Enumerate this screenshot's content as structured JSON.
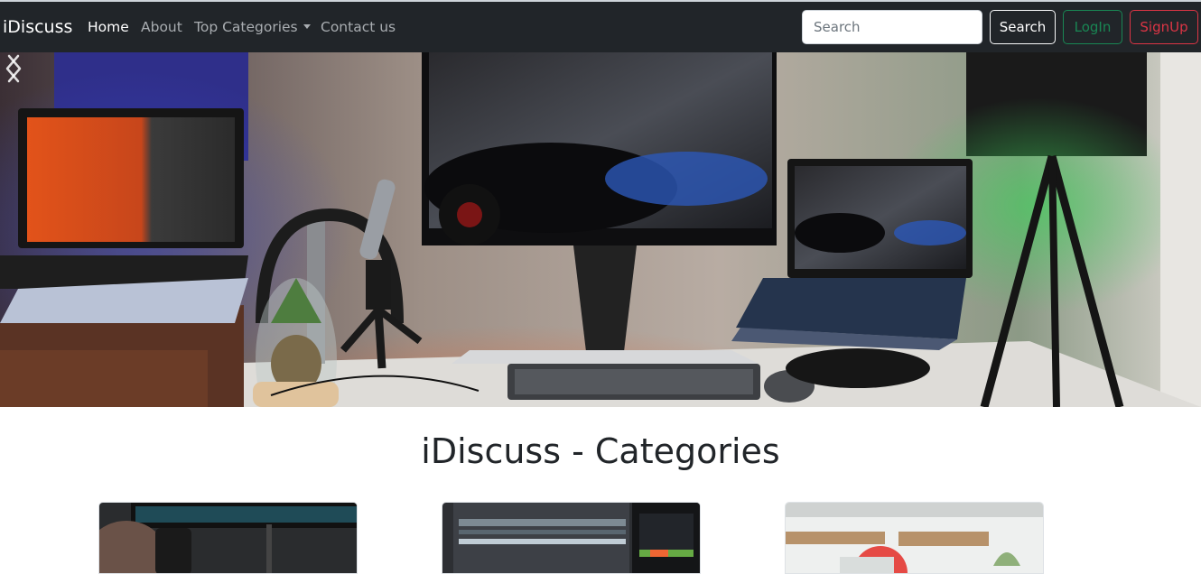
{
  "navbar": {
    "brand": "iDiscuss",
    "links": [
      {
        "label": "Home",
        "active": true
      },
      {
        "label": "About",
        "active": false
      },
      {
        "label": "Top Categories",
        "active": false,
        "dropdown": true
      },
      {
        "label": "Contact us",
        "active": false
      }
    ],
    "search_placeholder": "Search",
    "search_button": "Search",
    "login_button": "LogIn",
    "signup_button": "SignUp"
  },
  "hero": {
    "prev_icon": "chevron-left-icon",
    "next_icon": "chevron-right-icon"
  },
  "main": {
    "title": "iDiscuss - Categories"
  },
  "colors": {
    "navbar_bg": "#212529",
    "login": "#198754",
    "signup": "#dc3545"
  }
}
